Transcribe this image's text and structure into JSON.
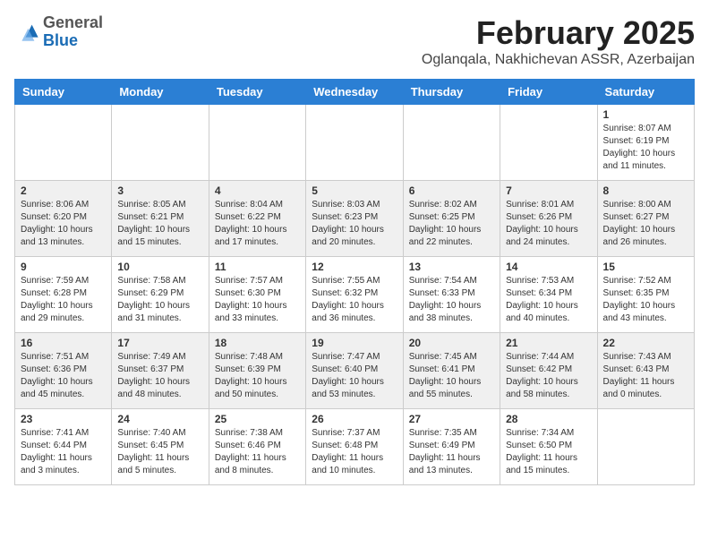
{
  "logo": {
    "general": "General",
    "blue": "Blue"
  },
  "header": {
    "title": "February 2025",
    "subtitle": "Oglanqala, Nakhichevan ASSR, Azerbaijan"
  },
  "days_of_week": [
    "Sunday",
    "Monday",
    "Tuesday",
    "Wednesday",
    "Thursday",
    "Friday",
    "Saturday"
  ],
  "weeks": [
    [
      {
        "day": "",
        "info": ""
      },
      {
        "day": "",
        "info": ""
      },
      {
        "day": "",
        "info": ""
      },
      {
        "day": "",
        "info": ""
      },
      {
        "day": "",
        "info": ""
      },
      {
        "day": "",
        "info": ""
      },
      {
        "day": "1",
        "info": "Sunrise: 8:07 AM\nSunset: 6:19 PM\nDaylight: 10 hours and 11 minutes."
      }
    ],
    [
      {
        "day": "2",
        "info": "Sunrise: 8:06 AM\nSunset: 6:20 PM\nDaylight: 10 hours and 13 minutes."
      },
      {
        "day": "3",
        "info": "Sunrise: 8:05 AM\nSunset: 6:21 PM\nDaylight: 10 hours and 15 minutes."
      },
      {
        "day": "4",
        "info": "Sunrise: 8:04 AM\nSunset: 6:22 PM\nDaylight: 10 hours and 17 minutes."
      },
      {
        "day": "5",
        "info": "Sunrise: 8:03 AM\nSunset: 6:23 PM\nDaylight: 10 hours and 20 minutes."
      },
      {
        "day": "6",
        "info": "Sunrise: 8:02 AM\nSunset: 6:25 PM\nDaylight: 10 hours and 22 minutes."
      },
      {
        "day": "7",
        "info": "Sunrise: 8:01 AM\nSunset: 6:26 PM\nDaylight: 10 hours and 24 minutes."
      },
      {
        "day": "8",
        "info": "Sunrise: 8:00 AM\nSunset: 6:27 PM\nDaylight: 10 hours and 26 minutes."
      }
    ],
    [
      {
        "day": "9",
        "info": "Sunrise: 7:59 AM\nSunset: 6:28 PM\nDaylight: 10 hours and 29 minutes."
      },
      {
        "day": "10",
        "info": "Sunrise: 7:58 AM\nSunset: 6:29 PM\nDaylight: 10 hours and 31 minutes."
      },
      {
        "day": "11",
        "info": "Sunrise: 7:57 AM\nSunset: 6:30 PM\nDaylight: 10 hours and 33 minutes."
      },
      {
        "day": "12",
        "info": "Sunrise: 7:55 AM\nSunset: 6:32 PM\nDaylight: 10 hours and 36 minutes."
      },
      {
        "day": "13",
        "info": "Sunrise: 7:54 AM\nSunset: 6:33 PM\nDaylight: 10 hours and 38 minutes."
      },
      {
        "day": "14",
        "info": "Sunrise: 7:53 AM\nSunset: 6:34 PM\nDaylight: 10 hours and 40 minutes."
      },
      {
        "day": "15",
        "info": "Sunrise: 7:52 AM\nSunset: 6:35 PM\nDaylight: 10 hours and 43 minutes."
      }
    ],
    [
      {
        "day": "16",
        "info": "Sunrise: 7:51 AM\nSunset: 6:36 PM\nDaylight: 10 hours and 45 minutes."
      },
      {
        "day": "17",
        "info": "Sunrise: 7:49 AM\nSunset: 6:37 PM\nDaylight: 10 hours and 48 minutes."
      },
      {
        "day": "18",
        "info": "Sunrise: 7:48 AM\nSunset: 6:39 PM\nDaylight: 10 hours and 50 minutes."
      },
      {
        "day": "19",
        "info": "Sunrise: 7:47 AM\nSunset: 6:40 PM\nDaylight: 10 hours and 53 minutes."
      },
      {
        "day": "20",
        "info": "Sunrise: 7:45 AM\nSunset: 6:41 PM\nDaylight: 10 hours and 55 minutes."
      },
      {
        "day": "21",
        "info": "Sunrise: 7:44 AM\nSunset: 6:42 PM\nDaylight: 10 hours and 58 minutes."
      },
      {
        "day": "22",
        "info": "Sunrise: 7:43 AM\nSunset: 6:43 PM\nDaylight: 11 hours and 0 minutes."
      }
    ],
    [
      {
        "day": "23",
        "info": "Sunrise: 7:41 AM\nSunset: 6:44 PM\nDaylight: 11 hours and 3 minutes."
      },
      {
        "day": "24",
        "info": "Sunrise: 7:40 AM\nSunset: 6:45 PM\nDaylight: 11 hours and 5 minutes."
      },
      {
        "day": "25",
        "info": "Sunrise: 7:38 AM\nSunset: 6:46 PM\nDaylight: 11 hours and 8 minutes."
      },
      {
        "day": "26",
        "info": "Sunrise: 7:37 AM\nSunset: 6:48 PM\nDaylight: 11 hours and 10 minutes."
      },
      {
        "day": "27",
        "info": "Sunrise: 7:35 AM\nSunset: 6:49 PM\nDaylight: 11 hours and 13 minutes."
      },
      {
        "day": "28",
        "info": "Sunrise: 7:34 AM\nSunset: 6:50 PM\nDaylight: 11 hours and 15 minutes."
      },
      {
        "day": "",
        "info": ""
      }
    ]
  ]
}
